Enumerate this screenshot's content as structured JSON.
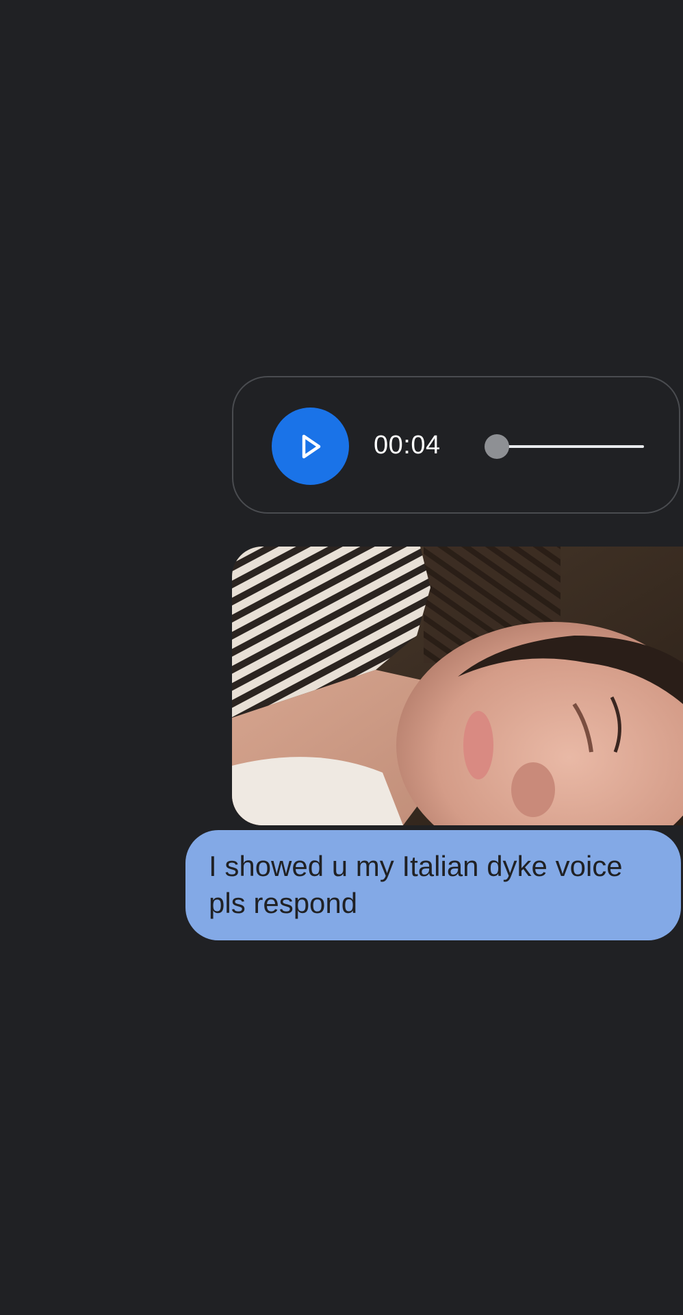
{
  "conversation": {
    "messages": [
      {
        "type": "audio",
        "duration": "00:04",
        "progress_fraction": 0.0,
        "play_icon": "play-icon"
      },
      {
        "type": "image",
        "alt": "photo-attachment"
      },
      {
        "type": "text",
        "text": "I showed u my Italian dyke voice pls respond"
      }
    ]
  },
  "colors": {
    "background": "#202124",
    "play_button": "#1a73e8",
    "text_bubble": "#83a9e6",
    "bubble_border": "#4a4c50"
  }
}
